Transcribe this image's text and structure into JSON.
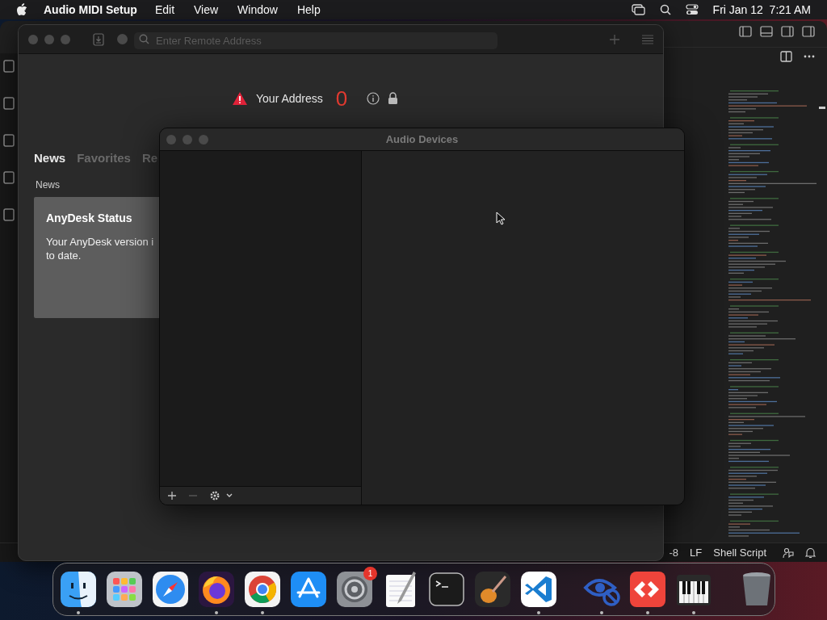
{
  "menu_bar": {
    "app_name": "Audio MIDI Setup",
    "menus": [
      "Edit",
      "View",
      "Window",
      "Help"
    ],
    "clock": "Fri Jan 12  7:21 AM"
  },
  "editor_window": {
    "status_bar": [
      "-8",
      "LF",
      "Shell Script"
    ]
  },
  "anydesk_window": {
    "search": {
      "placeholder": "Enter Remote Address"
    },
    "address_label": "Your Address",
    "address": "0",
    "tabs": [
      {
        "label": "News",
        "selected": true
      },
      {
        "label": "Favorites",
        "selected": false
      },
      {
        "label": "Re",
        "selected": false
      }
    ],
    "section_label": "News",
    "news_card": {
      "title": "AnyDesk Status",
      "lines": [
        "Your AnyDesk version i",
        "to date."
      ]
    }
  },
  "audio_window": {
    "title": "Audio Devices"
  },
  "dock": {
    "items": [
      {
        "kind": "finder",
        "running": true
      },
      {
        "kind": "launchpad",
        "running": false
      },
      {
        "kind": "safari",
        "running": false
      },
      {
        "kind": "firefox",
        "running": true
      },
      {
        "kind": "chrome",
        "running": true
      },
      {
        "kind": "appstore",
        "running": false
      },
      {
        "kind": "settings",
        "running": false,
        "badge": "1"
      },
      {
        "kind": "textedit",
        "running": false
      },
      {
        "kind": "terminal",
        "running": false
      },
      {
        "kind": "garageband",
        "running": false
      },
      {
        "kind": "vscode",
        "running": true
      },
      {
        "kind": "separator"
      },
      {
        "kind": "eye",
        "running": true
      },
      {
        "kind": "anydesk",
        "running": true
      },
      {
        "kind": "midi",
        "running": true
      },
      {
        "kind": "separator"
      },
      {
        "kind": "trash",
        "running": false
      }
    ]
  }
}
